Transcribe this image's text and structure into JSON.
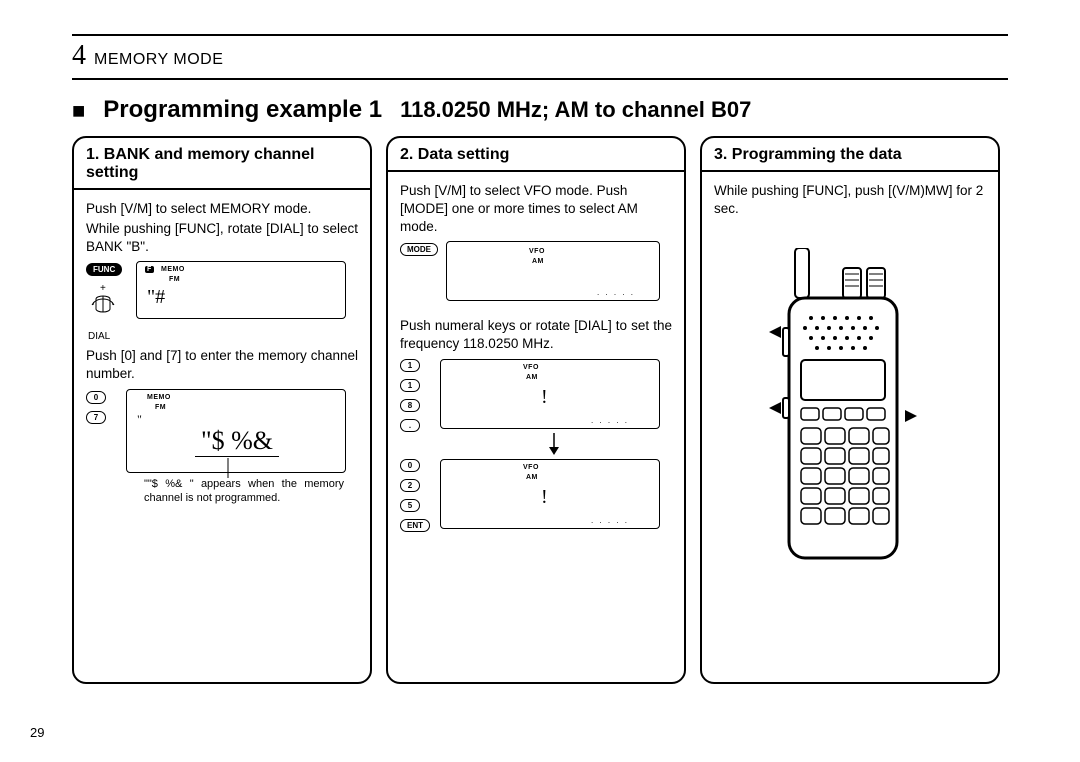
{
  "chapter": {
    "number": "4",
    "title": "MEMORY MODE"
  },
  "heading": {
    "main": "Programming example 1",
    "sub": "118.0250 MHz; AM to channel B07"
  },
  "col1": {
    "title": "1. BANK and memory channel setting",
    "p1": "Push [V/M] to select MEMORY mode.",
    "p2": "While pushing [FUNC], rotate [DIAL] to select BANK \"B\".",
    "func_label": "FUNC",
    "plus": "+",
    "dial_label": "DIAL",
    "lcd1": {
      "memo": "MEMO",
      "fm": "FM",
      "f": "F",
      "val": "\"#"
    },
    "p3": "Push [0] and [7] to enter the memory channel number.",
    "k0": "0",
    "k7": "7",
    "lcd2": {
      "memo": "MEMO",
      "fm": "FM",
      "val_top": "\"",
      "val_big": "\"$ %&"
    },
    "note": "\"\"$ %& \" appears when the memory channel is not programmed."
  },
  "col2": {
    "title": "2. Data setting",
    "p1": "Push [V/M] to select VFO mode. Push [MODE] one or more times to select AM mode.",
    "mode_key": "MODE",
    "lcd1": {
      "vfo": "VFO",
      "am": "AM"
    },
    "p2": "Push numeral keys or rotate [DIAL] to set the frequency 118.0250 MHz.",
    "keys_a": [
      "1",
      "1",
      "8",
      "."
    ],
    "keys_b": [
      "0",
      "2",
      "5",
      "ENT"
    ],
    "lcd2": {
      "vfo": "VFO",
      "am": "AM",
      "val": "!"
    },
    "lcd3": {
      "vfo": "VFO",
      "am": "AM",
      "val": "!"
    }
  },
  "col3": {
    "title": "3. Programming the data",
    "p1": "While pushing [FUNC], push [(V/M)MW] for 2 sec."
  },
  "page_number": "29"
}
